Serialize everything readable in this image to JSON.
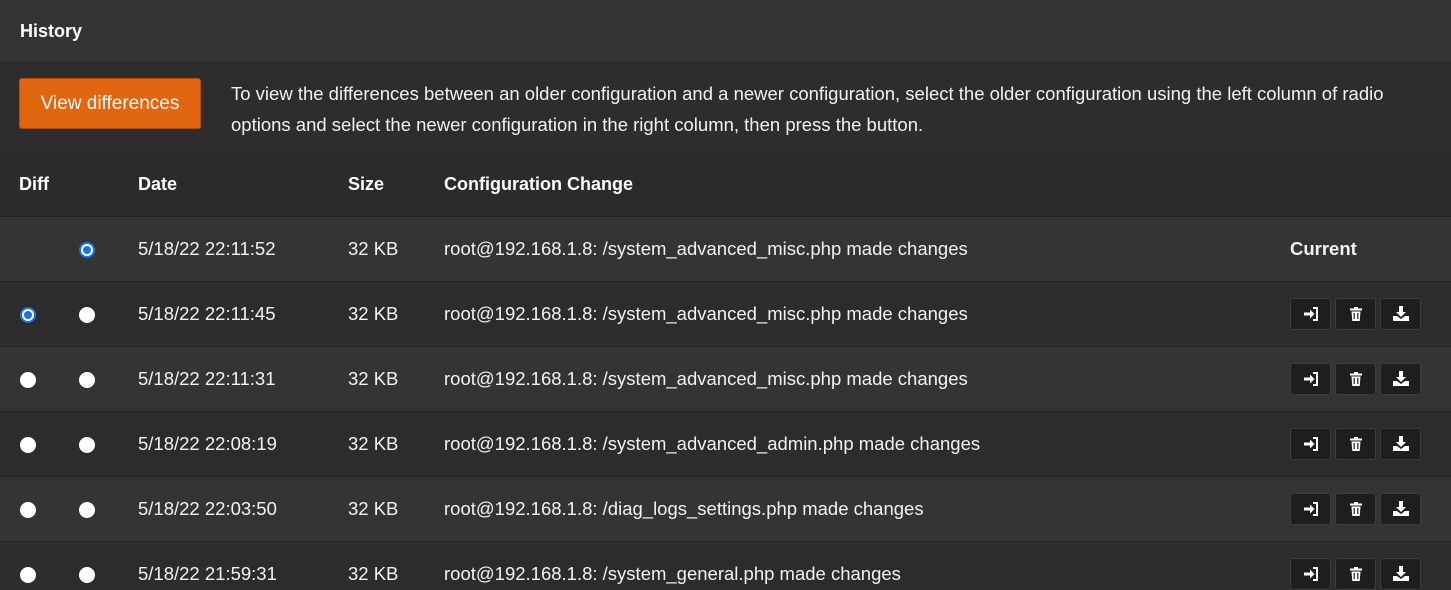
{
  "panel": {
    "title": "History"
  },
  "intro": {
    "button_label": "View differences",
    "text": "To view the differences between an older configuration and a newer configuration, select the older configuration using the left column of radio options and select the newer configuration in the right column, then press the button."
  },
  "table": {
    "headers": {
      "diff": "Diff",
      "date": "Date",
      "size": "Size",
      "change": "Configuration Change"
    },
    "current_label": "Current",
    "rows": [
      {
        "diff_old": null,
        "diff_new": true,
        "date": "5/18/22 22:11:52",
        "size": "32 KB",
        "change": "root@192.168.1.8: /system_advanced_misc.php made changes",
        "is_current": true
      },
      {
        "diff_old": true,
        "diff_new": false,
        "date": "5/18/22 22:11:45",
        "size": "32 KB",
        "change": "root@192.168.1.8: /system_advanced_misc.php made changes",
        "is_current": false
      },
      {
        "diff_old": false,
        "diff_new": false,
        "date": "5/18/22 22:11:31",
        "size": "32 KB",
        "change": "root@192.168.1.8: /system_advanced_misc.php made changes",
        "is_current": false
      },
      {
        "diff_old": false,
        "diff_new": false,
        "date": "5/18/22 22:08:19",
        "size": "32 KB",
        "change": "root@192.168.1.8: /system_advanced_admin.php made changes",
        "is_current": false
      },
      {
        "diff_old": false,
        "diff_new": false,
        "date": "5/18/22 22:03:50",
        "size": "32 KB",
        "change": "root@192.168.1.8: /diag_logs_settings.php made changes",
        "is_current": false
      },
      {
        "diff_old": false,
        "diff_new": false,
        "date": "5/18/22 21:59:31",
        "size": "32 KB",
        "change": "root@192.168.1.8: /system_general.php made changes",
        "is_current": false
      }
    ],
    "row_actions": [
      "restore-icon",
      "trash-icon",
      "download-icon"
    ]
  },
  "colors": {
    "accent": "#e2650f",
    "radio_checked": "#1a73e8",
    "background": "#2b2b2b"
  }
}
